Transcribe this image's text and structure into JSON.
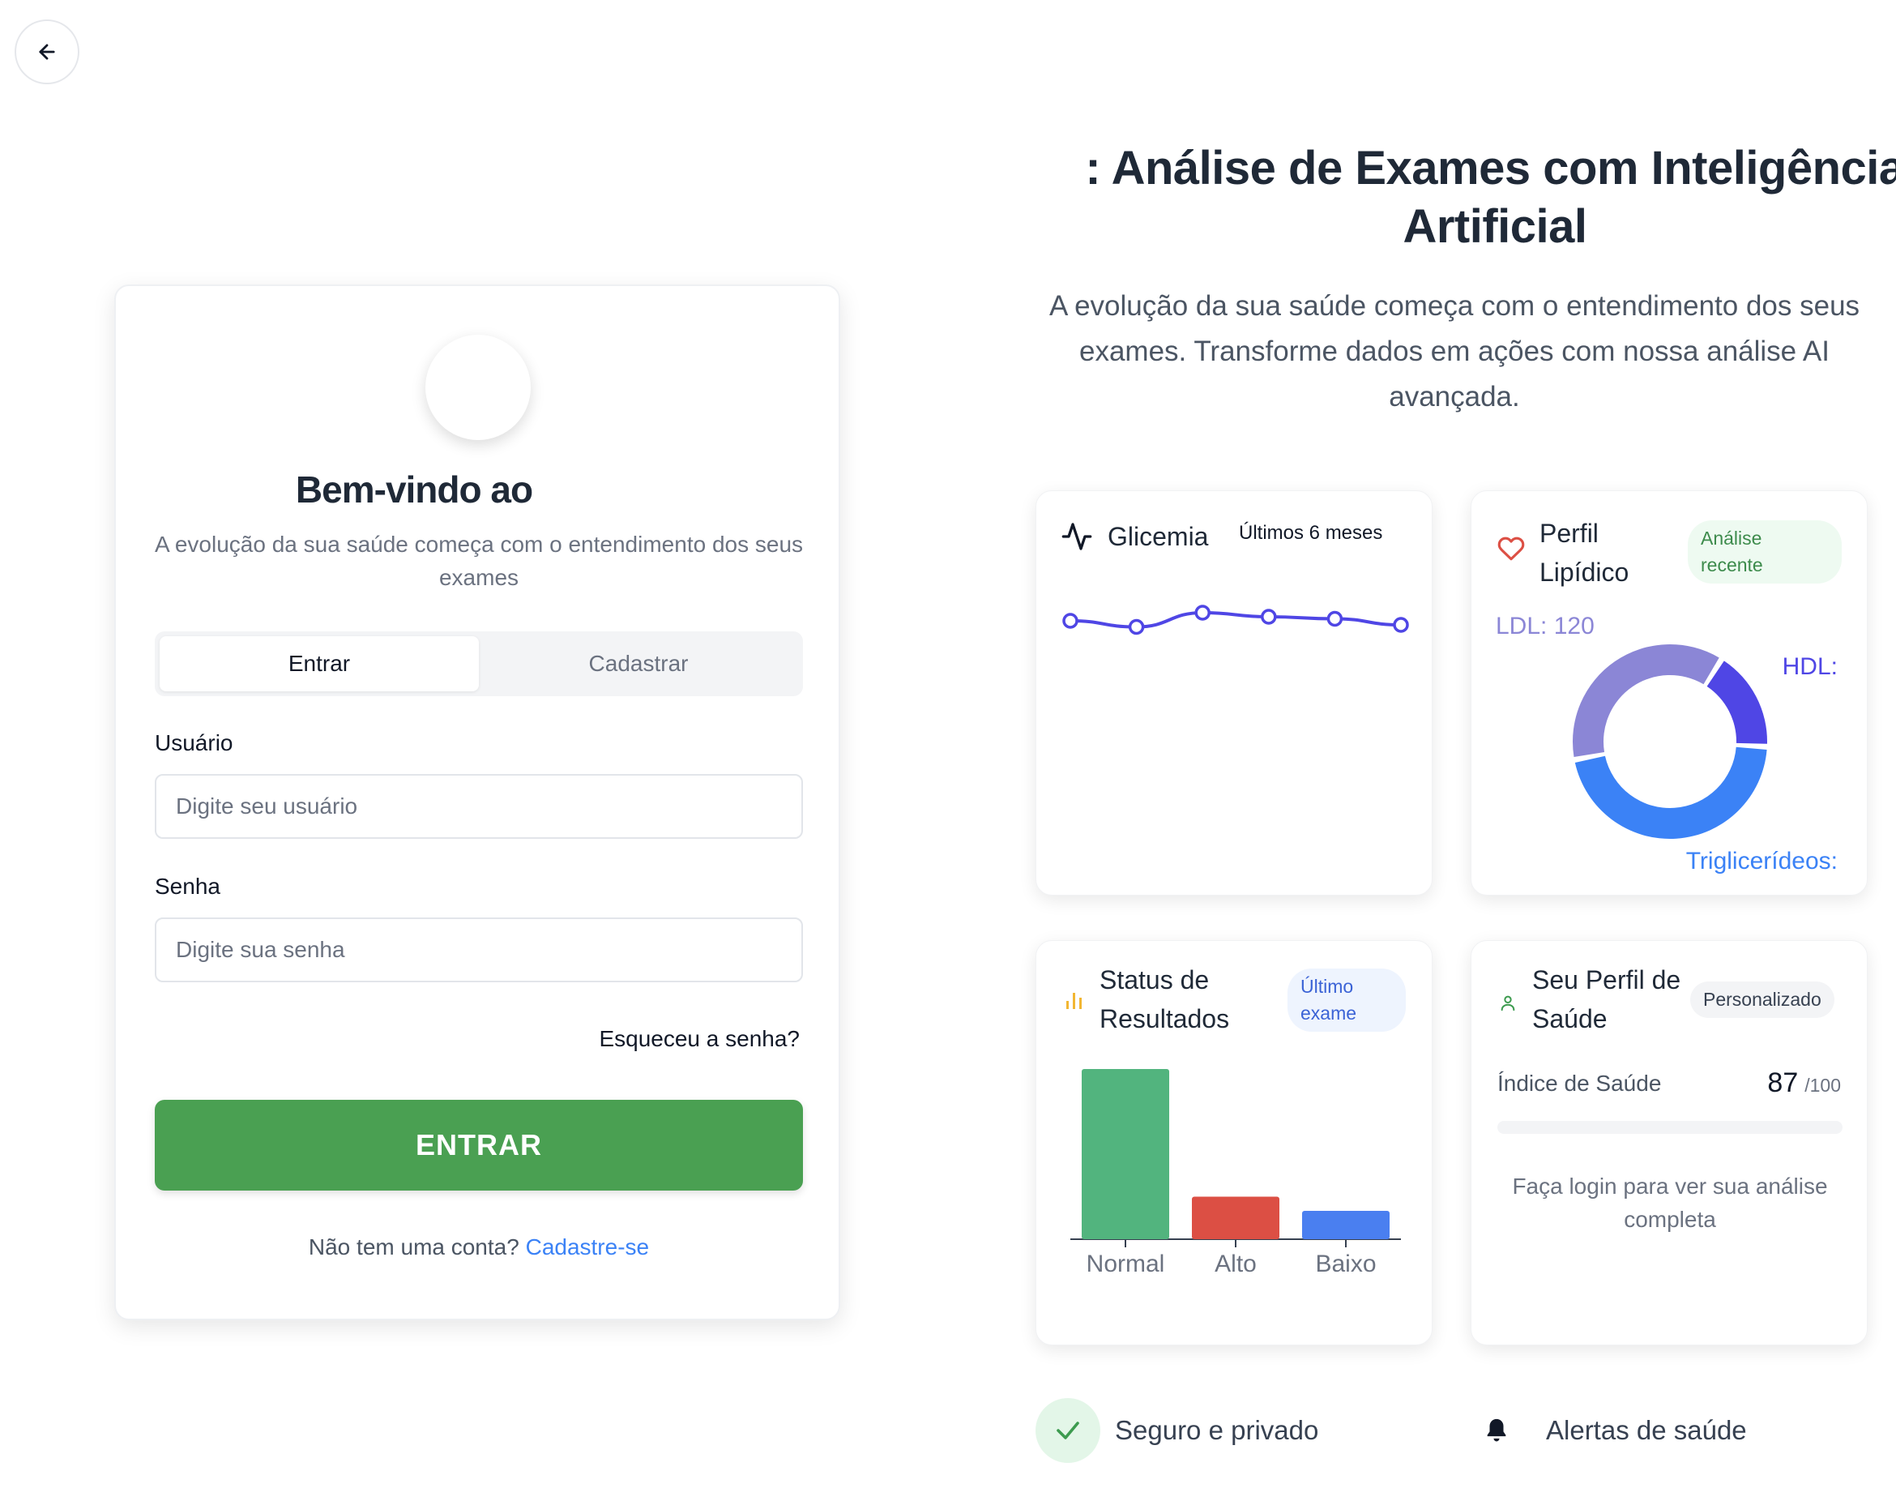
{
  "login": {
    "title": "Bem-vindo ao",
    "subtitle": "A evolução da sua saúde começa com o entendimento dos seus exames",
    "tabs": [
      "Entrar",
      "Cadastrar"
    ],
    "username_label": "Usuário",
    "username_placeholder": "Digite seu usuário",
    "password_label": "Senha",
    "password_placeholder": "Digite sua senha",
    "forgot": "Esqueceu a senha?",
    "submit": "ENTRAR",
    "no_account": "Não tem uma conta?",
    "signup_link": "Cadastre-se"
  },
  "hero": {
    "title": ": Análise de Exames com Inteligência Artificial",
    "subtitle": "A evolução da sua saúde começa com o entendimento dos seus exames. Transforme dados em ações com nossa análise AI avançada."
  },
  "glicemia": {
    "title": "Glicemia",
    "period": "Últimos 6 meses",
    "icon": "activity-icon",
    "line_color": "#4f46e5"
  },
  "lipid": {
    "title": "Perfil Lipídico",
    "badge": "Análise recente",
    "icon": "heart-icon",
    "labels": {
      "ldl": "LDL: 120",
      "hdl": "HDL:",
      "trig": "Triglicerídeos:"
    }
  },
  "status": {
    "title": "Status de Resultados",
    "badge": "Último exame",
    "icon": "bar-chart-icon"
  },
  "profile": {
    "title": "Seu Perfil de Saúde",
    "badge": "Personalizado",
    "icon": "user-icon",
    "index_label": "Índice de Saúde",
    "index_value": "87",
    "index_max": "/100",
    "login_hint": "Faça login para ver sua análise completa"
  },
  "features": {
    "secure": "Seguro e privado",
    "alerts": "Alertas de saúde"
  },
  "chart_data": [
    {
      "type": "line",
      "title": "Glicemia",
      "x": [
        1,
        2,
        3,
        4,
        5,
        6
      ],
      "values": [
        96,
        93,
        100,
        98,
        97,
        94
      ],
      "ylim": [
        80,
        110
      ]
    },
    {
      "type": "pie",
      "title": "Perfil Lipídico",
      "categories": [
        "LDL",
        "HDL",
        "Triglicerídeos"
      ],
      "values": [
        120,
        55,
        150
      ],
      "colors": [
        "#8b86d6",
        "#4f46e5",
        "#3b82f6"
      ]
    },
    {
      "type": "bar",
      "title": "Status de Resultados",
      "categories": [
        "Normal",
        "Alto",
        "Baixo"
      ],
      "values": [
        12,
        3,
        2
      ],
      "colors": [
        "#52b47e",
        "#dc4f44",
        "#4a7ff0"
      ],
      "ylim": [
        0,
        12
      ]
    }
  ]
}
